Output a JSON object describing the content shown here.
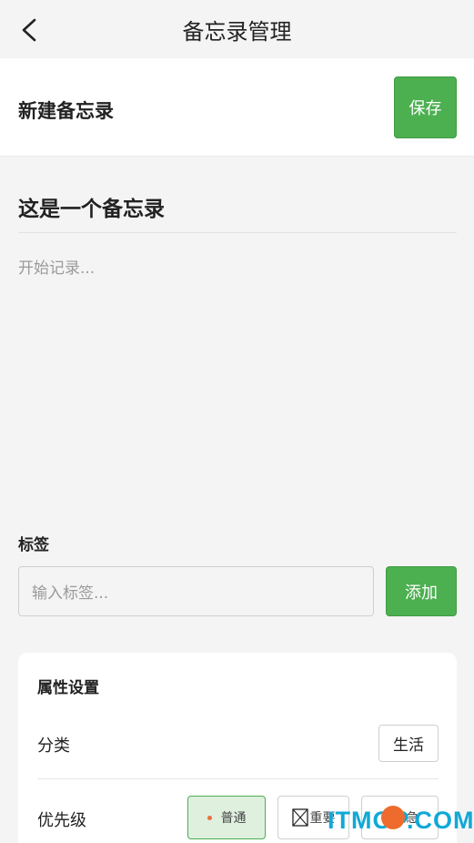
{
  "nav": {
    "title": "备忘录管理"
  },
  "header": {
    "title": "新建备忘录",
    "save_label": "保存"
  },
  "memo": {
    "title": "这是一个备忘录",
    "body_placeholder": "开始记录..."
  },
  "tags": {
    "label": "标签",
    "input_placeholder": "输入标签...",
    "add_label": "添加"
  },
  "properties": {
    "title": "属性设置",
    "category_label": "分类",
    "category_value": "生活",
    "priority_label": "优先级",
    "priority_options": [
      "普通",
      "重要",
      "紧急"
    ],
    "selected_priority": "普通"
  },
  "watermark": "ITMOP.COM",
  "colors": {
    "accent": "#4caf50",
    "urgent": "#ee6b2d",
    "watermark": "#12a8d6"
  },
  "icons": {
    "back": "chevron-left-icon"
  }
}
